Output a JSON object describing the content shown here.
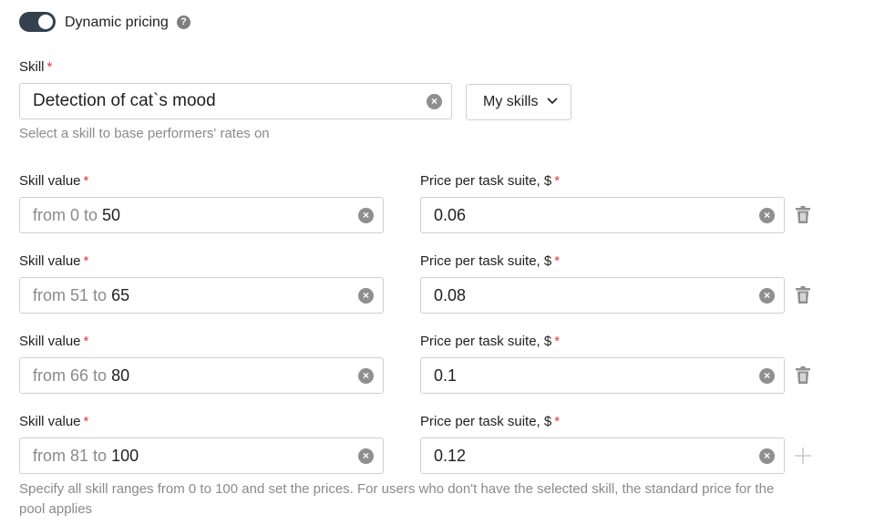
{
  "dynamic_pricing": {
    "enabled": true,
    "label": "Dynamic pricing",
    "help_glyph": "?"
  },
  "skill": {
    "label": "Skill",
    "required_mark": "*",
    "value": "Detection of cat`s mood",
    "clear_glyph": "×",
    "my_skills_label": "My skills",
    "hint": "Select a skill to base performers' rates on"
  },
  "ranges": [
    {
      "skill_label": "Skill value",
      "from_text": "from 0 to",
      "to_value": "50",
      "price_label": "Price per task suite, $",
      "price": "0.06",
      "action": "delete"
    },
    {
      "skill_label": "Skill value",
      "from_text": "from 51 to",
      "to_value": "65",
      "price_label": "Price per task suite, $",
      "price": "0.08",
      "action": "delete"
    },
    {
      "skill_label": "Skill value",
      "from_text": "from 66 to",
      "to_value": "80",
      "price_label": "Price per task suite, $",
      "price": "0.1",
      "action": "delete"
    },
    {
      "skill_label": "Skill value",
      "from_text": "from 81 to",
      "to_value": "100",
      "price_label": "Price per task suite, $",
      "price": "0.12",
      "action": "add"
    }
  ],
  "footer_hint": "Specify all skill ranges from 0 to 100 and set the prices. For users who don't have the selected skill, the standard price for the pool applies",
  "colors": {
    "toggle_on": "#34414e",
    "required": "#e8333a",
    "border": "#cfcfcf",
    "muted_text": "#8a8a8a"
  }
}
